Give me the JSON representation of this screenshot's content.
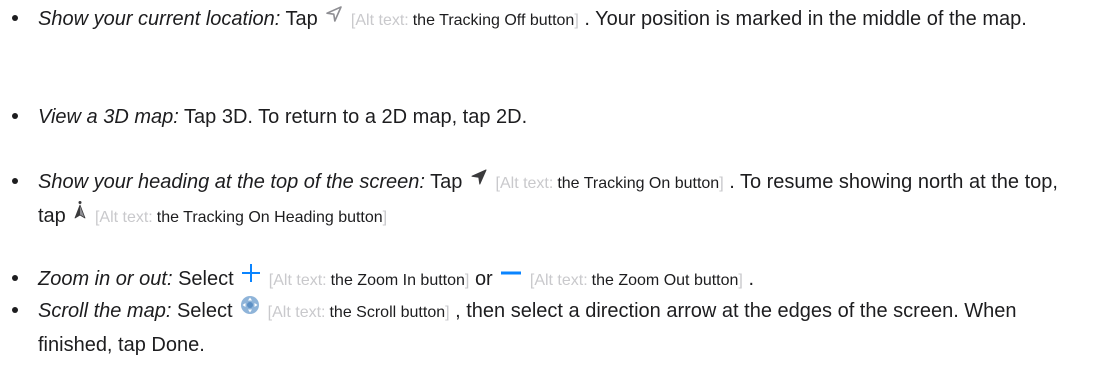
{
  "alt_prefix": "Alt text:",
  "items": [
    {
      "term": "Show your current location:",
      "parts": [
        "Tap",
        ". Your position is marked in the middle of the map."
      ],
      "alts": [
        "the Tracking Off button"
      ]
    },
    {
      "term": "View a 3D map:",
      "text": "Tap 3D. To return to a 2D map, tap 2D."
    },
    {
      "term": "Show your heading at the top of the screen:",
      "parts": [
        "Tap",
        ". To resume showing north at the top, tap"
      ],
      "alts": [
        "the Tracking On button",
        "the Tracking On Heading button"
      ]
    },
    {
      "term": "Zoom in or out:",
      "parts": [
        "Select",
        "or",
        "."
      ],
      "alts": [
        "the Zoom In button",
        "the Zoom Out button"
      ]
    },
    {
      "term": "Scroll the map:",
      "parts": [
        "Select",
        ", then select a direction arrow at the edges of the screen. When finished, tap Done."
      ],
      "alts": [
        "the Scroll button"
      ]
    }
  ],
  "colors": {
    "text": "#1d1d1f",
    "alt_muted": "#c9c9cc",
    "icon_gray": "#8e8e93",
    "icon_dark": "#3a3a3c",
    "accent_blue": "#0a84ff"
  },
  "icons": [
    "location-arrow-outline-icon",
    "location-arrow-filled-icon",
    "heading-icon",
    "plus-icon",
    "minus-icon",
    "scroll-icon"
  ]
}
